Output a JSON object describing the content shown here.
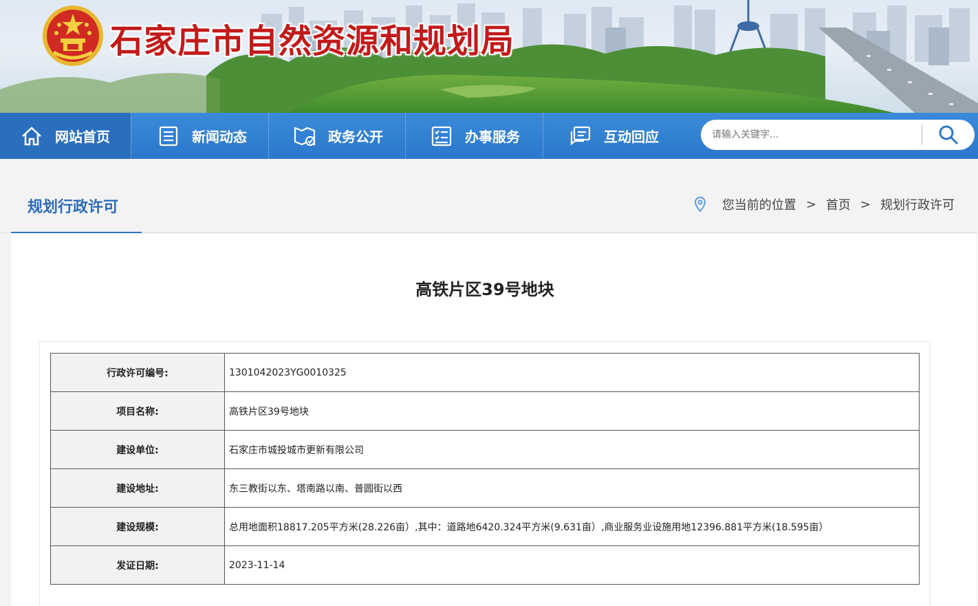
{
  "header": {
    "site_title": "石家庄市自然资源和规划局"
  },
  "nav": {
    "items": [
      {
        "label": "网站首页",
        "icon": "home-icon"
      },
      {
        "label": "新闻动态",
        "icon": "news-icon"
      },
      {
        "label": "政务公开",
        "icon": "government-affairs-icon"
      },
      {
        "label": "办事服务",
        "icon": "service-list-icon"
      },
      {
        "label": "互动回应",
        "icon": "chat-icon"
      }
    ],
    "search_placeholder": "请输入关键字..."
  },
  "section": {
    "title": "规划行政许可",
    "breadcrumb": {
      "prefix": "您当前的位置",
      "separator": ">",
      "items": [
        "首页",
        "规划行政许可"
      ]
    }
  },
  "document": {
    "title": "高铁片区39号地块",
    "rows": [
      {
        "key": "行政许可编号:",
        "value": "1301042023YG0010325"
      },
      {
        "key": "项目名称:",
        "value": "高铁片区39号地块"
      },
      {
        "key": "建设单位:",
        "value": "石家庄市城投城市更新有限公司"
      },
      {
        "key": "建设地址:",
        "value": "东三教街以东、塔南路以南、普圆街以西"
      },
      {
        "key": "建设规模:",
        "value": "总用地面积18817.205平方米(28.226亩）,其中：道路地6420.324平方米(9.631亩）,商业服务业设施用地12396.881平方米(18.595亩）"
      },
      {
        "key": "发证日期:",
        "value": "2023-11-14"
      }
    ]
  },
  "colors": {
    "nav_blue": "#2b78cc",
    "title_red": "#c21a1a",
    "section_blue": "#2b6cb8"
  }
}
